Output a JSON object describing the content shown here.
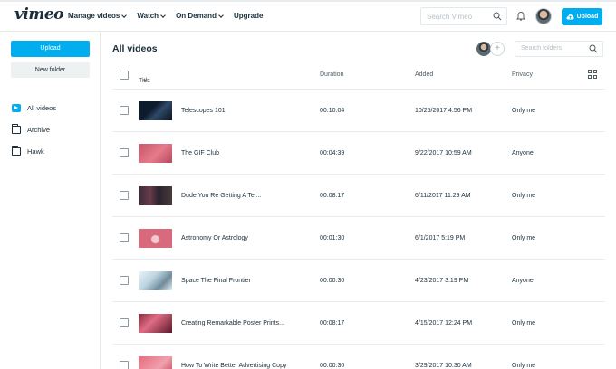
{
  "nav": {
    "logo": "vimeo",
    "menu": [
      {
        "label": "Manage videos",
        "has_dropdown": true
      },
      {
        "label": "Watch",
        "has_dropdown": true
      },
      {
        "label": "On Demand",
        "has_dropdown": true
      },
      {
        "label": "Upgrade",
        "has_dropdown": false
      }
    ],
    "search_placeholder": "Search Vimeo",
    "upload_label": "Upload"
  },
  "sidebar": {
    "upload_label": "Upload",
    "new_folder_label": "New folder",
    "items": [
      {
        "label": "All videos",
        "icon": "all-videos-icon",
        "selected": true
      },
      {
        "label": "Archive",
        "icon": "folder-icon"
      },
      {
        "label": "Hawk",
        "icon": "folder-icon"
      }
    ]
  },
  "main": {
    "title": "All videos",
    "folder_search_placeholder": "Search folders",
    "columns": {
      "title": "Title",
      "duration": "Duration",
      "added": "Added",
      "privacy": "Privacy"
    },
    "rows": [
      {
        "title": "Telescopes 101",
        "duration": "00:10:04",
        "added": "10/25/2017 4:56 PM",
        "privacy": "Only me"
      },
      {
        "title": "The GIF Club",
        "duration": "00:04:39",
        "added": "9/22/2017 10:59 AM",
        "privacy": "Anyone"
      },
      {
        "title": "Dude You Re Getting A Tel...",
        "duration": "00:08:17",
        "added": "6/11/2017 11:29 AM",
        "privacy": "Only me"
      },
      {
        "title": "Astronomy Or Astrology",
        "duration": "00:01:30",
        "added": "6/1/2017 5:19 PM",
        "privacy": "Only me"
      },
      {
        "title": "Space The Final Frontier",
        "duration": "00:00:30",
        "added": "4/23/2017 3:19 PM",
        "privacy": "Anyone"
      },
      {
        "title": "Creating Remarkable Poster Prints...",
        "duration": "00:08:17",
        "added": "4/15/2017 12:24 PM",
        "privacy": "Only me"
      },
      {
        "title": "How To Write Better Advertising Copy",
        "duration": "00:00:30",
        "added": "3/29/2017 10:30 AM",
        "privacy": "Only me"
      }
    ]
  },
  "colors": {
    "accent": "#00adef",
    "text": "#1a2e3b",
    "border": "#e3e8e9"
  }
}
